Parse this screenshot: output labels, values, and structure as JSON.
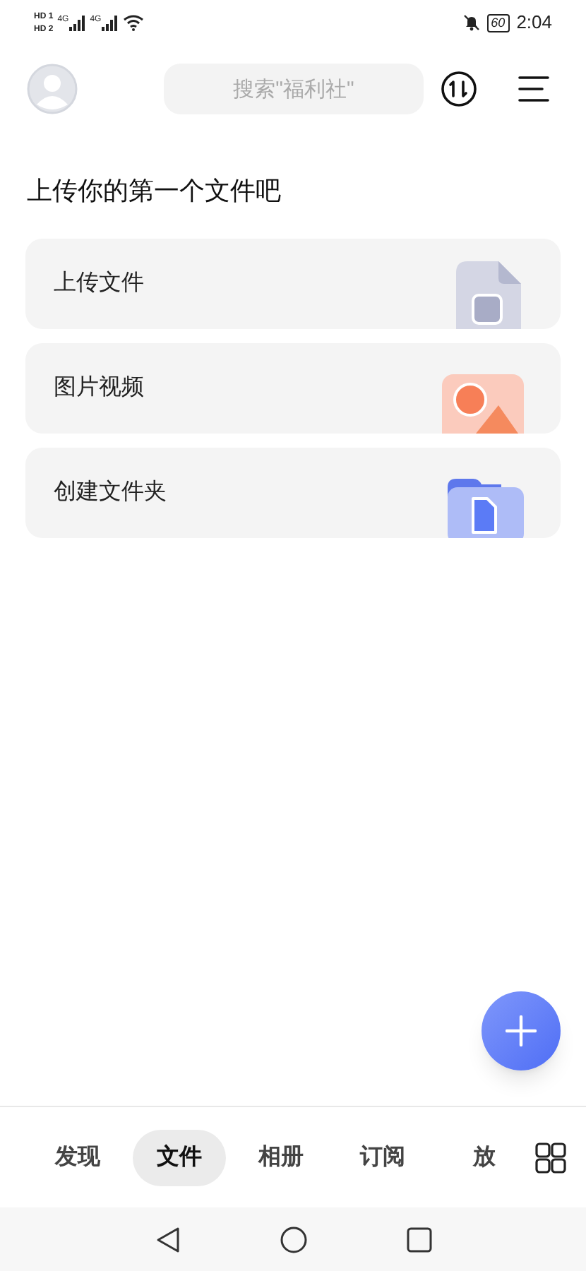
{
  "status_bar": {
    "sims": [
      {
        "badge": "HD",
        "slot": "1",
        "network": "4G"
      },
      {
        "badge": "HD",
        "slot": "2",
        "network": "4G"
      }
    ],
    "battery": "60",
    "time": "2:04"
  },
  "header": {
    "search": {
      "placeholder": "搜索\"福利社\""
    }
  },
  "title": "上传你的第一个文件吧",
  "cards": [
    {
      "label": "上传文件",
      "kind": "document"
    },
    {
      "label": "图片视频",
      "kind": "image"
    },
    {
      "label": "创建文件夹",
      "kind": "folder"
    }
  ],
  "tabs": [
    {
      "label": "发现",
      "selected": false
    },
    {
      "label": "文件",
      "selected": true
    },
    {
      "label": "相册",
      "selected": false
    },
    {
      "label": "订阅",
      "selected": false
    },
    {
      "label": "放",
      "selected": false
    }
  ]
}
